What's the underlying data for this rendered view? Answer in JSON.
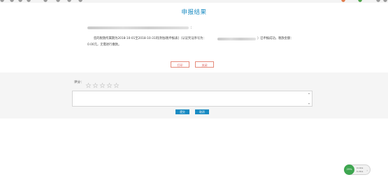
{
  "page": {
    "title": "申报结果",
    "colon": "：",
    "message_part1": "您的税款所属期为2018-10-01至2018-10-31的[附加税申报表]（认证凭证序号为：",
    "message_part2": "）已申报成功，税款金额：",
    "message_line2": "0.00元，无需进行缴款。"
  },
  "actions": {
    "print_label": "打印",
    "close_label": "关闭"
  },
  "rating": {
    "label": "评分：",
    "stars": [
      "☆",
      "☆",
      "☆",
      "☆",
      "☆"
    ],
    "value": 0
  },
  "comment": {
    "value": "",
    "placeholder": ""
  },
  "form_buttons": {
    "submit_label": "提交",
    "cancel_label": "取消"
  },
  "widget": {
    "status_label": "25%",
    "stat1": "0.1K/s",
    "stat2": "0.2K/s",
    "arrow": "›"
  },
  "colors": {
    "accent": "#1a8bc2",
    "outline_button": "#d9534f",
    "widget_green": "#3ea650"
  }
}
